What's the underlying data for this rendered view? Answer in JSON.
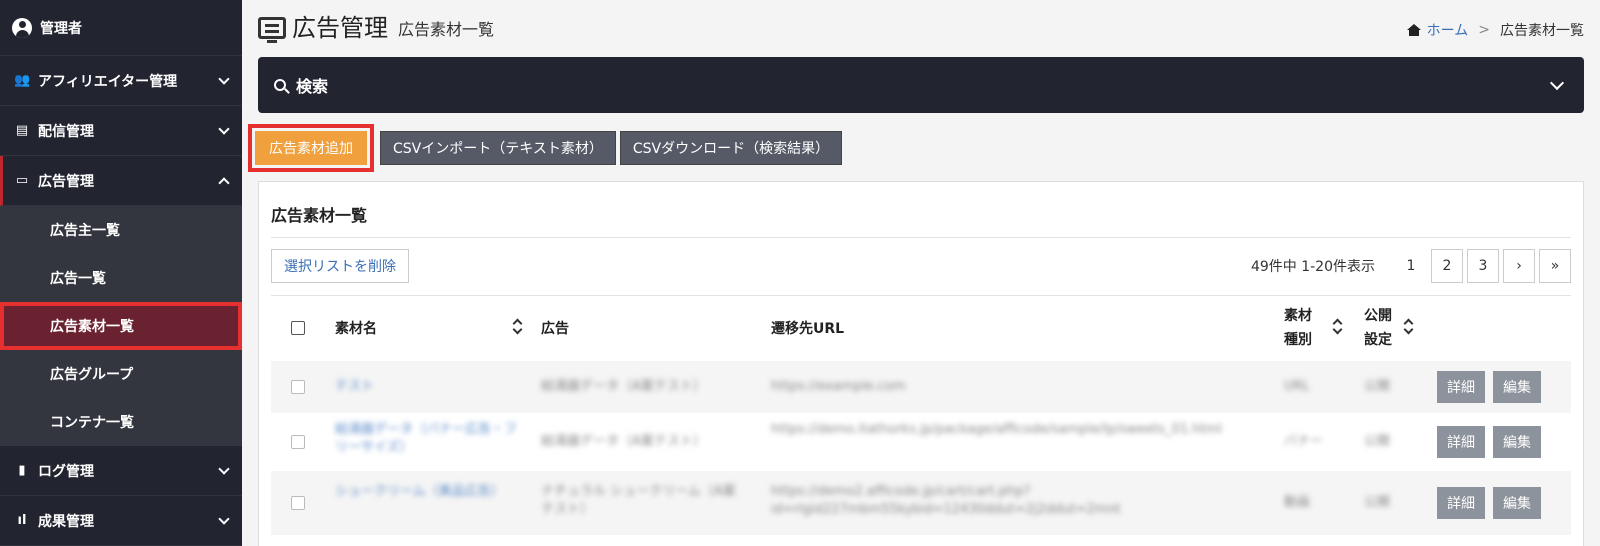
{
  "sidebar": {
    "user": "管理者",
    "items": [
      {
        "label": "アフィリエイター管理",
        "icon": "users-icon"
      },
      {
        "label": "配信管理",
        "icon": "delivery-icon"
      },
      {
        "label": "広告管理",
        "icon": "ad-icon"
      }
    ],
    "sub_items": [
      "広告主一覧",
      "広告一覧",
      "広告素材一覧",
      "広告グループ",
      "コンテナ一覧"
    ],
    "bottom_items": [
      {
        "label": "ログ管理",
        "icon": "document-icon"
      },
      {
        "label": "成果管理",
        "icon": "bar-chart-icon"
      }
    ]
  },
  "header": {
    "title": "広告管理",
    "subtitle": "広告素材一覧"
  },
  "breadcrumb": {
    "home": "ホーム",
    "separator": ">",
    "current": "広告素材一覧"
  },
  "search": {
    "label": "検索"
  },
  "actions": {
    "add": "広告素材追加",
    "csv_import": "CSVインポート（テキスト素材）",
    "csv_download": "CSVダウンロード（検索結果）"
  },
  "panel": {
    "title": "広告素材一覧",
    "delete_selected": "選択リストを削除",
    "pager_info": "49件中 1-20件表示",
    "pages": [
      "1",
      "2",
      "3",
      "›",
      "»"
    ]
  },
  "table": {
    "headers": {
      "name": "素材名",
      "ad": "広告",
      "url": "遷移先URL",
      "type_line1": "素材",
      "type_line2": "種別",
      "public_line1": "公開",
      "public_line2": "設定"
    },
    "rows": [
      {
        "name": "テスト",
        "ad": "給湯器データ（A案テスト）",
        "url": "https://example.com",
        "type": "URL",
        "public": "公開"
      },
      {
        "name": "給湯器データ（バナー広告・フリーサイズ）",
        "ad": "給湯器データ（A案テスト）",
        "url": "https://demo.itathorks.jp/package/afficode/sample/lp/sweets_01.html",
        "type": "バナー",
        "public": "公開"
      },
      {
        "name": "シュークリーム（美品広告）",
        "ad": "ナチュラル シュークリーム（A案テスト）",
        "url": "https://demo2.afficode.jp/cart/cart.php?id=rlgid227mbm55kybid=12430ddut=2j2ddut=2mnt",
        "type": "動画",
        "public": "公開"
      }
    ],
    "detail_label": "詳細",
    "edit_label": "編集"
  }
}
